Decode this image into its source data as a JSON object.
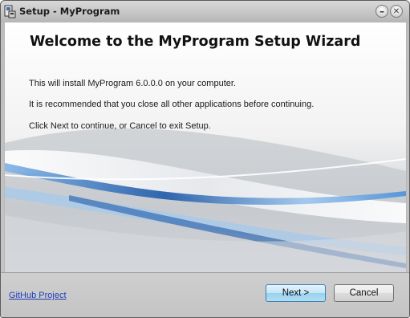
{
  "window": {
    "title": "Setup - MyProgram",
    "minimize_glyph": "–",
    "close_glyph": "✕",
    "app_icon": "installer-icon"
  },
  "welcome": {
    "heading": "Welcome to the MyProgram Setup Wizard",
    "paragraphs": [
      "This will install MyProgram 6.0.0.0 on your computer.",
      "It is recommended that you close all other applications before continuing.",
      "Click Next to continue, or Cancel to exit Setup."
    ]
  },
  "footer": {
    "link_label": "GitHub Project",
    "next_label": "Next >",
    "cancel_label": "Cancel"
  },
  "colors": {
    "link": "#1f3fbf",
    "next_button": "#c4e5f6",
    "swoosh_blue": "#1f5aa8"
  }
}
